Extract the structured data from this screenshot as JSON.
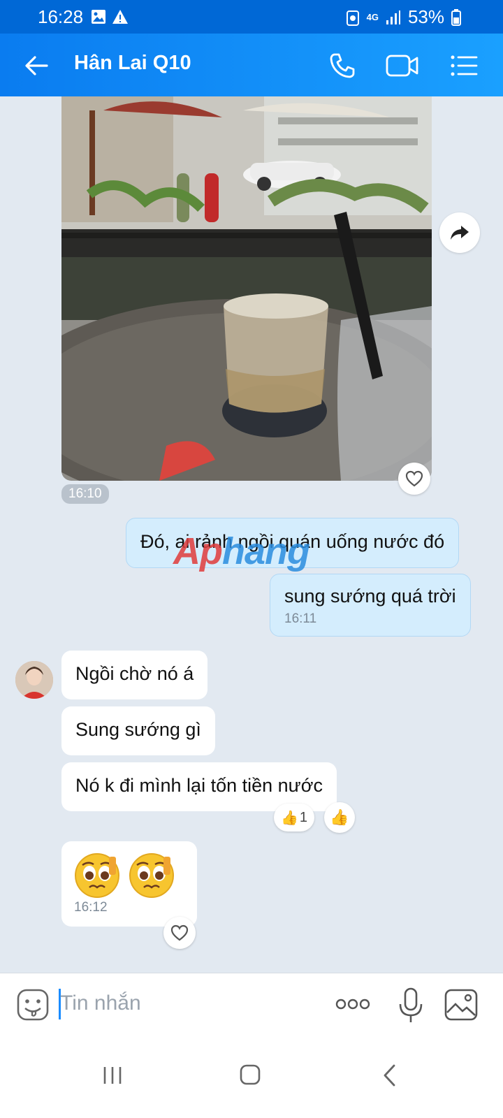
{
  "status": {
    "time": "16:28",
    "network": "4G",
    "battery": "53%"
  },
  "header": {
    "title": "Hân Lai Q10"
  },
  "messages": {
    "photo_time": "16:10",
    "sent1": "Đó, ai rảnh ngồi quán uống nước đó",
    "sent2": "sung sướng quá trời",
    "sent2_time": "16:11",
    "recv1": "Ngồi chờ nó á",
    "recv2": "Sung sướng gì",
    "recv3": "Nó k đi mình lại tốn tiền nước",
    "recv3_reaction_count": "1",
    "recv4_time": "16:12"
  },
  "watermark": {
    "part1": "Ap",
    "part2": "hang"
  },
  "input": {
    "placeholder": "Tin nhắn"
  },
  "colors": {
    "header": "#0a7cf0",
    "sent_bubble": "#d4edfd",
    "background": "#e2e9f1"
  }
}
